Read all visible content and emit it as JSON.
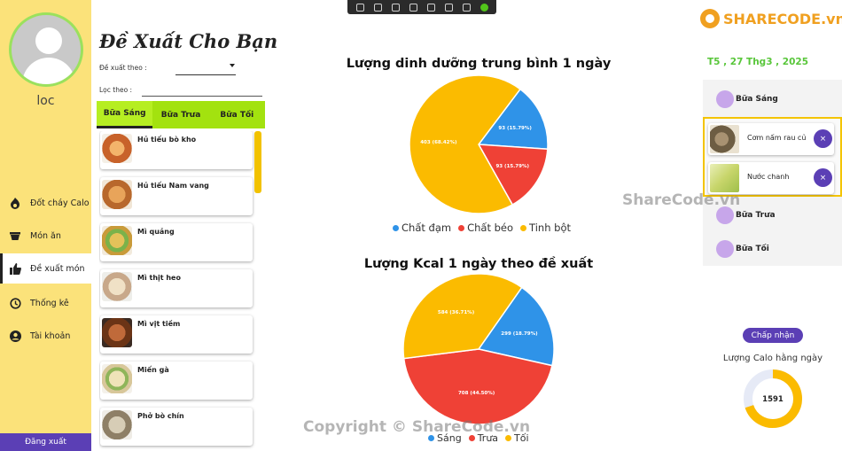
{
  "user": {
    "name": "loc"
  },
  "sidebar": {
    "items": [
      {
        "label": "Đốt cháy Calo",
        "icon": "flame-icon"
      },
      {
        "label": "Món ăn",
        "icon": "bowl-icon"
      },
      {
        "label": "Đề xuất món",
        "icon": "thumbs-up-icon",
        "active": true
      },
      {
        "label": "Thống kê",
        "icon": "history-icon"
      },
      {
        "label": "Tài khoản",
        "icon": "account-icon"
      }
    ],
    "logout_label": "Đăng xuất"
  },
  "suggest": {
    "title": "Đề Xuất Cho Bạn",
    "suggest_by_label": "Đề xuất theo :",
    "suggest_by_value": "",
    "filter_label": "Lọc theo :",
    "filter_value": "",
    "tabs": [
      {
        "label": "Bữa Sáng",
        "active": true
      },
      {
        "label": "Bữa Trưa"
      },
      {
        "label": "Bữa Tối"
      }
    ],
    "foods": [
      {
        "name": "Hủ tiếu bò kho",
        "color": "#c8622a"
      },
      {
        "name": "Hủ tiếu Nam vang",
        "color": "#d9893c"
      },
      {
        "name": "Mì quảng",
        "color": "#c99b3a"
      },
      {
        "name": "Mì thịt heo",
        "color": "#e2d4bf"
      },
      {
        "name": "Mì vịt tiềm",
        "color": "#8a4b2a"
      },
      {
        "name": "Miến gà",
        "color": "#d8c79a"
      },
      {
        "name": "Phở bò chín",
        "color": "#b7a98c"
      }
    ]
  },
  "charts": {
    "colors": {
      "blue": "#2f93e8",
      "red": "#ef4136",
      "yellow": "#fbbb00"
    }
  },
  "chart_data": [
    {
      "type": "pie",
      "title": "Lượng dinh dưỡng trung bình 1 ngày",
      "categories": [
        "Chất đạm",
        "Chất béo",
        "Tinh bột"
      ],
      "values": [
        93,
        93,
        403
      ],
      "data_labels": [
        "93 (15.79%)",
        "93 (15.79%)",
        "403 (68.42%)"
      ]
    },
    {
      "type": "pie",
      "title": "Lượng Kcal 1 ngày theo đề xuất",
      "categories": [
        "Sáng",
        "Trưa",
        "Tối"
      ],
      "values": [
        299,
        708,
        584
      ],
      "data_labels": [
        "299 (18.79%)",
        "708 (44.50%)",
        "584 (36.71%)"
      ]
    }
  ],
  "watermark": "Copyright © ShareCode.vn",
  "watermark_side": "ShareCode.vn",
  "brand": "SHARECODE.vn",
  "right": {
    "date": "T5 , 27 Thg3 , 2025",
    "meals": {
      "breakfast": "Bữa Sáng",
      "lunch": "Bữa Trưa",
      "dinner": "Bữa Tối"
    },
    "added": [
      {
        "name": "Cơm nấm rau củ",
        "color": "#7b6a4d"
      },
      {
        "name": "Nước chanh",
        "color": "#c7d56a"
      }
    ],
    "remove_symbol": "×",
    "accept_label": "Chấp nhận",
    "calo_label": "Lượng Calo hằng ngày",
    "calo_value": "1591",
    "calo_fraction": 0.7
  }
}
